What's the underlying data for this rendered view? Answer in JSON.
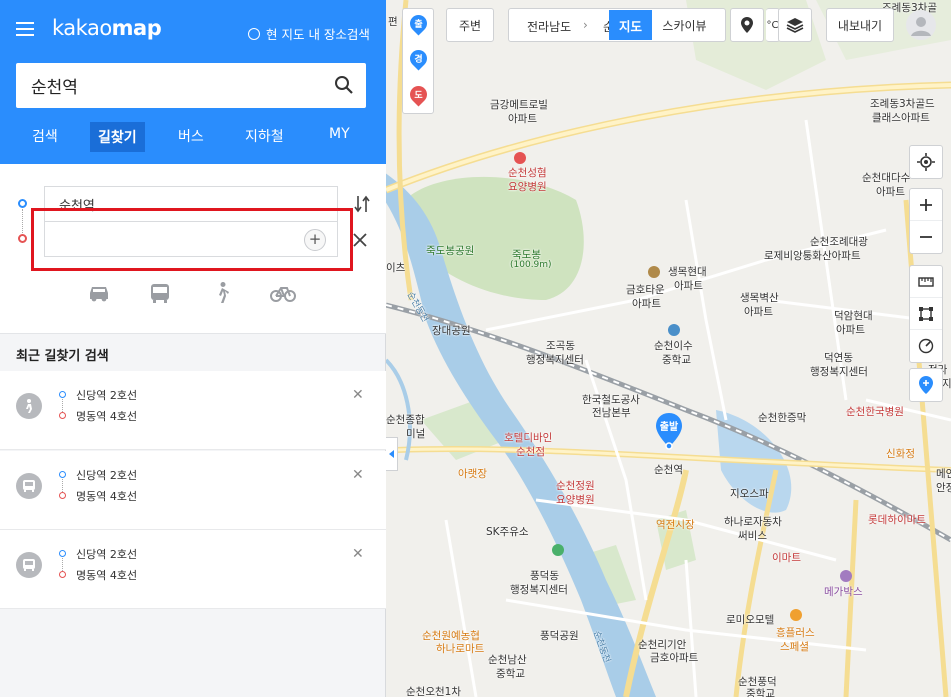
{
  "header": {
    "logo_prefix": "kakao",
    "logo_suffix": "map",
    "area_search_label": "현 지도 내 장소검색",
    "search_value": "순천역"
  },
  "tabs": [
    {
      "label": "검색"
    },
    {
      "label": "길찾기",
      "active": true
    },
    {
      "label": "버스"
    },
    {
      "label": "지하철"
    },
    {
      "label": "MY"
    }
  ],
  "route": {
    "from_value": "순천역",
    "to_value": "",
    "add_stop_symbol": "+"
  },
  "transport_modes": [
    "car-icon",
    "bus-icon",
    "walk-icon",
    "bike-icon"
  ],
  "recent": {
    "title": "최근 길찾기 검색",
    "items": [
      {
        "from": "신당역 2호선",
        "to": "명동역 4호선",
        "icon": "walk-transfer-icon"
      },
      {
        "from": "신당역 2호선",
        "to": "명동역 4호선",
        "icon": "transit-icon"
      },
      {
        "from": "신당역 2호선",
        "to": "명동역 4호선",
        "icon": "transit-icon"
      }
    ]
  },
  "map_toolbar": {
    "nearby": "주변",
    "region_1": "전라남도",
    "region_2": "순",
    "map": "지도",
    "skyview": "스카이뷰",
    "export": "내보내기",
    "marker_start": "출",
    "marker_via": "경",
    "marker_end": "도"
  },
  "pin_label": "출발",
  "map_labels": {
    "l1": "금강메트로빌",
    "l2": "아파트",
    "l3": "순천성혐",
    "l4": "요양병원",
    "l5": "죽도봉공원",
    "l6": "죽도봉",
    "l7": "(100.9m)",
    "l8": "생목현대",
    "l9": "아파트",
    "l10": "금호타운",
    "l11": "아파트",
    "l12": "생목벽산",
    "l13": "아파트",
    "l14": "조곡동",
    "l15": "행정복지센터",
    "l16": "순천이수",
    "l17": "중학교",
    "l18": "장대공원",
    "l19": "한국철도공사",
    "l20": "전남본부",
    "l21": "호텔디바인",
    "l22": "순천점",
    "l23": "순천역",
    "l24": "지오스파",
    "l25": "순천정원",
    "l26": "요양병원",
    "l27": "아랫장",
    "l28": "역전시장",
    "l29": "하나로자동차",
    "l30": "써비스",
    "l31": "이마트",
    "l32": "SK주유소",
    "l33": "풍덕동",
    "l34": "행정복지센터",
    "l35": "로미오모텔",
    "l36": "풍덕공원",
    "l37": "순천리기안",
    "l38": "흥플러스",
    "l39": "스페셜",
    "l40": "순천원예농협",
    "l41": "하나로마트",
    "l42": "순천남산",
    "l43": "중학교",
    "l44": "금호아파트",
    "l45": "순천풍덕",
    "l46": "중학교",
    "l47": "순천오천1차",
    "l48": "조례동3차골드",
    "l49": "클래스아파트",
    "l50": "순천대다수",
    "l51": "아파트",
    "l52": "순천조례대광",
    "l53": "로제비앙퉁화산아파트",
    "l54": "덕암현대",
    "l55": "아파트",
    "l56": "덕연동",
    "l57": "행정복지센터",
    "l58": "순천한국병원",
    "l59": "순천한증막",
    "l60": "신화정",
    "l61": "롯데하이마트",
    "l62": "메가박스",
    "l63": "순천종합",
    "l64": "미널",
    "l65": "편",
    "l66": "이츠",
    "l67": "조례동3차골",
    "l68": "정라",
    "l69": "지",
    "l70": "메인",
    "l71": "안정",
    "l72": "순천동천",
    "l73": "순천동천"
  }
}
